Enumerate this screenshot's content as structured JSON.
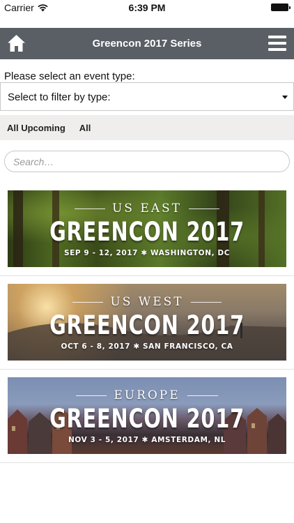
{
  "status_bar": {
    "carrier": "Carrier",
    "time": "6:39 PM"
  },
  "header": {
    "title": "Greencon 2017 Series",
    "home_icon": "home-icon",
    "menu_icon": "hamburger-menu-icon",
    "background": "#5a5f66"
  },
  "filter": {
    "label": "Please select an event type:",
    "selected": "Select to filter by type:"
  },
  "tabs": [
    {
      "label": "All Upcoming"
    },
    {
      "label": "All"
    }
  ],
  "search": {
    "placeholder": "Search…"
  },
  "events": [
    {
      "region": "US EAST",
      "brand": "GREENCON 2017",
      "dates": "SEP 9 - 12, 2017 ✱ WASHINGTON, DC"
    },
    {
      "region": "US WEST",
      "brand": "GREENCON 2017",
      "dates": "OCT 6 - 8, 2017 ✱ SAN FRANCISCO, CA"
    },
    {
      "region": "EUROPE",
      "brand": "GREENCON 2017",
      "dates": "NOV 3 - 5, 2017 ✱ AMSTERDAM, NL"
    }
  ]
}
